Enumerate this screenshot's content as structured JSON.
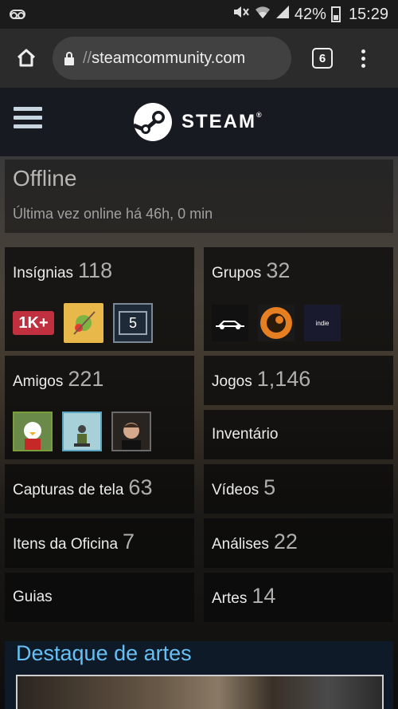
{
  "status_bar": {
    "battery": "42%",
    "time": "15:29"
  },
  "browser": {
    "url_prefix": "//",
    "url_domain": "steamcommunity.com",
    "tab_count": "6"
  },
  "header": {
    "logo_text": "STEAM"
  },
  "profile": {
    "status": "Offline",
    "last_online": "Última vez online há 46h, 0 min"
  },
  "tiles": {
    "badges": {
      "label": "Insígnias",
      "count": "118",
      "badge_1k": "1K+",
      "badge_level": "5"
    },
    "groups": {
      "label": "Grupos",
      "count": "32",
      "group_3_text": "indie"
    },
    "friends": {
      "label": "Amigos",
      "count": "221"
    },
    "games": {
      "label": "Jogos",
      "count": "1,146"
    },
    "inventory": {
      "label": "Inventário"
    },
    "screenshots": {
      "label": "Capturas de tela",
      "count": "63"
    },
    "videos": {
      "label": "Vídeos",
      "count": "5"
    },
    "workshop": {
      "label": "Itens da Oficina",
      "count": "7"
    },
    "reviews": {
      "label": "Análises",
      "count": "22"
    },
    "guides": {
      "label": "Guias"
    },
    "artwork": {
      "label": "Artes",
      "count": "14"
    }
  },
  "showcase": {
    "title": "Destaque de artes"
  },
  "colors": {
    "accent": "#66c0f4",
    "header_bg": "#171a21"
  }
}
